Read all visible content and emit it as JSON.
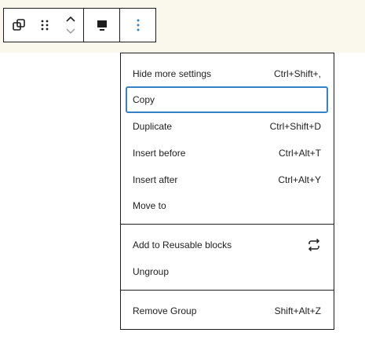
{
  "toolbar": {
    "buttons": [
      {
        "icon": "group-icon"
      },
      {
        "icon": "drag-handle-icon"
      },
      {
        "icon": "move-up-down-icon"
      },
      {
        "icon": "align-icon"
      },
      {
        "icon": "more-options-icon"
      }
    ],
    "accent": "#3582c4"
  },
  "menu": {
    "items": [
      {
        "label": "Hide more settings",
        "shortcut": "Ctrl+Shift+,"
      },
      {
        "label": "Copy",
        "shortcut": ""
      },
      {
        "label": "Duplicate",
        "shortcut": "Ctrl+Shift+D"
      },
      {
        "label": "Insert before",
        "shortcut": "Ctrl+Alt+T"
      },
      {
        "label": "Insert after",
        "shortcut": "Ctrl+Alt+Y"
      },
      {
        "label": "Move to",
        "shortcut": ""
      },
      {
        "label": "Add to Reusable blocks",
        "icon": "reusable-block-icon"
      },
      {
        "label": "Ungroup",
        "shortcut": ""
      },
      {
        "label": "Remove Group",
        "shortcut": "Shift+Alt+Z"
      }
    ]
  }
}
